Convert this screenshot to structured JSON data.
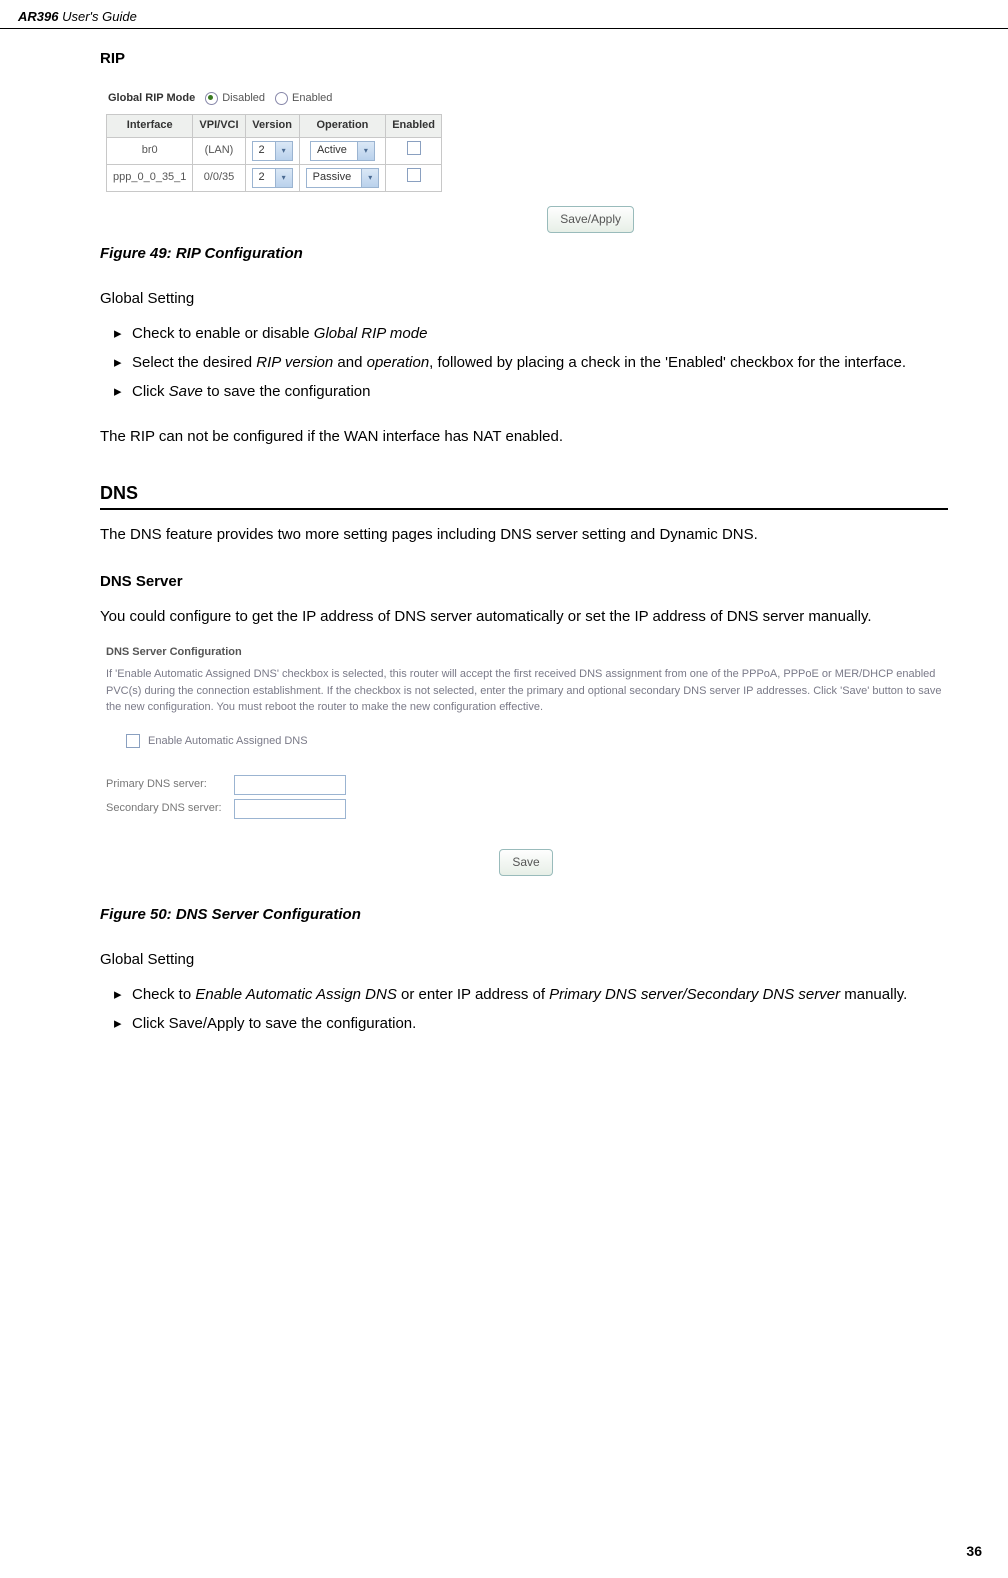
{
  "header": {
    "product": "AR396",
    "suffix": " User's Guide"
  },
  "rip": {
    "title": "RIP",
    "shot": {
      "mode_label": "Global RIP Mode",
      "disabled": "Disabled",
      "enabled": "Enabled",
      "cols": {
        "iface": "Interface",
        "vpivci": "VPI/VCI",
        "version": "Version",
        "operation": "Operation",
        "enabled": "Enabled"
      },
      "rows": [
        {
          "iface": "br0",
          "vpivci": "(LAN)",
          "version": "2",
          "operation": "Active"
        },
        {
          "iface": "ppp_0_0_35_1",
          "vpivci": "0/0/35",
          "version": "2",
          "operation": "Passive"
        }
      ],
      "button": "Save/Apply"
    },
    "caption": "Figure 49: RIP Configuration",
    "global_setting": "Global Setting",
    "b1_a": "Check to enable or disable ",
    "b1_b": "Global RIP mode",
    "b2_a": "Select the desired ",
    "b2_b": "RIP version",
    "b2_c": " and ",
    "b2_d": "operation",
    "b2_e": ", followed by placing a check in the 'Enabled' checkbox for the interface.",
    "b3_a": "Click ",
    "b3_b": "Save",
    "b3_c": " to save the configuration",
    "note": "The RIP can not be configured if the WAN interface has NAT enabled."
  },
  "dns": {
    "h2": "DNS",
    "intro": "The DNS feature provides two more setting pages including DNS server setting and Dynamic DNS.",
    "server_title": "DNS Server",
    "server_text": "You could configure to get the IP address of DNS server automatically or set the IP address of DNS server manually.",
    "shot": {
      "hd": "DNS Server Configuration",
      "desc": "If 'Enable Automatic Assigned DNS' checkbox is selected, this router will accept the first received DNS assignment from one of the PPPoA, PPPoE or MER/DHCP enabled PVC(s) during the connection establishment. If the checkbox is not selected, enter the primary and optional secondary DNS server IP addresses. Click 'Save' button to save the new configuration. You must reboot the router to make the new configuration effective.",
      "chk_label": "Enable Automatic Assigned DNS",
      "primary": "Primary DNS server:",
      "secondary": "Secondary DNS server:",
      "button": "Save"
    },
    "caption": "Figure 50: DNS Server Configuration",
    "global_setting": "Global Setting",
    "b1_a": "Check to ",
    "b1_b": "Enable Automatic Assign DNS",
    "b1_c": " or enter IP address of ",
    "b1_d": "Primary DNS server/Secondary DNS server",
    "b1_e": " manually.",
    "b2": "Click Save/Apply to save the configuration."
  },
  "page_number": "36"
}
